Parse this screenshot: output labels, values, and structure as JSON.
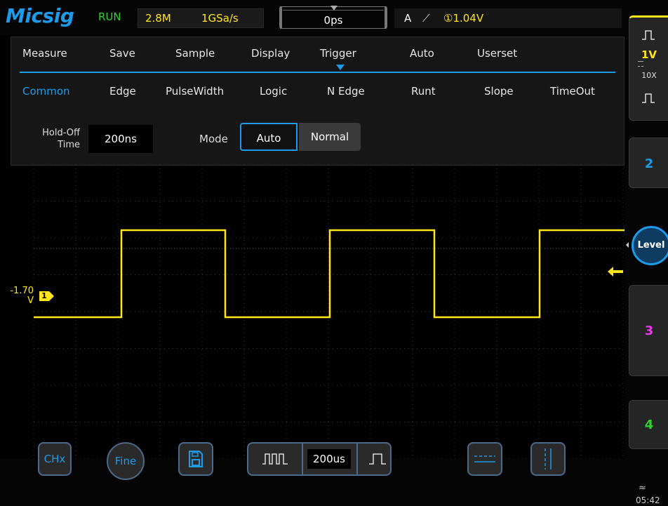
{
  "header": {
    "logo": "Micsig",
    "run_state": "RUN",
    "memory_depth": "2.8M",
    "sample_rate": "1GSa/s",
    "horizontal_position": "0ps",
    "trigger_source": "A",
    "trigger_edge": "⟋",
    "trigger_level": "①1.04V"
  },
  "menu": {
    "top_items": [
      "Measure",
      "Save",
      "Sample",
      "Display",
      "Trigger",
      "Auto",
      "Userset"
    ],
    "selected_top": "Trigger",
    "sub_items": [
      "Common",
      "Edge",
      "PulseWidth",
      "Logic",
      "N Edge",
      "Runt",
      "Slope",
      "TimeOut"
    ],
    "selected_sub": "Common",
    "holdoff_label_1": "Hold-Off",
    "holdoff_label_2": "Time",
    "holdoff_value": "200ns",
    "mode_label": "Mode",
    "mode_options": [
      "Auto",
      "Normal"
    ],
    "mode_selected": "Auto"
  },
  "waveform": {
    "ch1_offset_label_1": "-1.70",
    "ch1_offset_label_2": "V",
    "ch1_marker": "1",
    "color": "#ffe51a"
  },
  "right_panel": {
    "ch1_scale": "1V",
    "ch1_probe": "10X",
    "level_button": "Level",
    "ch2": "2",
    "ch3": "3",
    "ch4": "4",
    "colors": {
      "ch1": "#ffe51a",
      "ch2": "#1e9be8",
      "ch3": "#e83ae8",
      "ch4": "#2ed32e"
    }
  },
  "bottom": {
    "chx": "CHx",
    "fine": "Fine",
    "timebase": "200us",
    "time": "05:42"
  }
}
